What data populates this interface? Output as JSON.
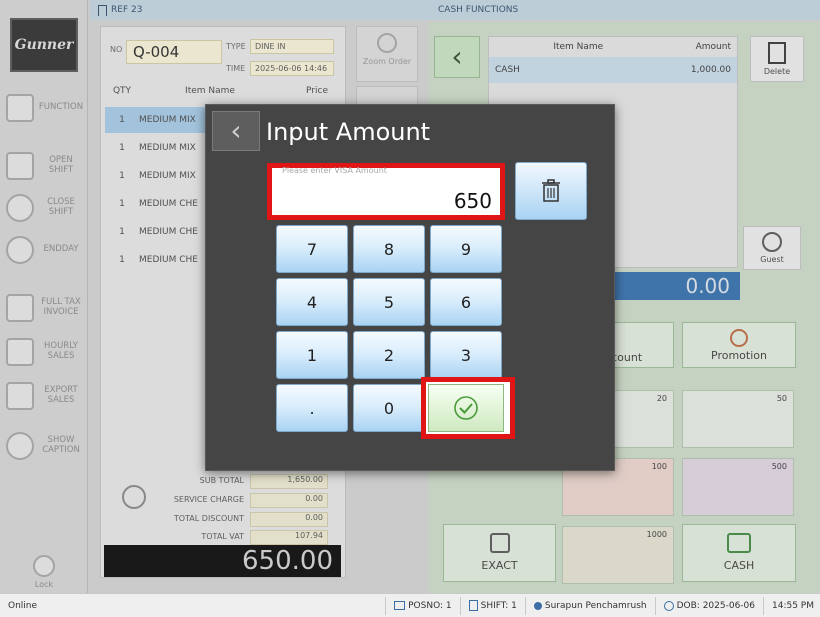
{
  "sidebar": {
    "logo_text": "Gunner",
    "items": [
      {
        "label": "FUNCTION",
        "icon": "menu-icon"
      },
      {
        "label": "OPEN SHIFT",
        "icon": "register-icon"
      },
      {
        "label": "CLOSE SHIFT",
        "icon": "clock-icon"
      },
      {
        "label": "ENDDAY",
        "icon": "gear-icon"
      },
      {
        "label": "FULL TAX INVOICE",
        "icon": "invoice-icon"
      },
      {
        "label": "HOURLY SALES",
        "icon": "report-icon"
      },
      {
        "label": "EXPORT SALES",
        "icon": "export-icon"
      },
      {
        "label": "SHOW CAPTION",
        "icon": "help-icon"
      }
    ],
    "lock_label": "Lock"
  },
  "order": {
    "ref_label": "REF 23",
    "no_label": "NO",
    "no_value": "Q-004",
    "type_label": "TYPE",
    "type_value": "DINE IN",
    "time_label": "TIME",
    "time_value": "2025-06-06 14:46",
    "col_qty": "QTY",
    "col_item": "Item Name",
    "col_price": "Price",
    "items": [
      {
        "qty": "1",
        "name": "MEDIUM MIX"
      },
      {
        "qty": "1",
        "name": "MEDIUM MIX"
      },
      {
        "qty": "1",
        "name": "MEDIUM MIX"
      },
      {
        "qty": "1",
        "name": "MEDIUM CHE"
      },
      {
        "qty": "1",
        "name": "MEDIUM CHE"
      },
      {
        "qty": "1",
        "name": "MEDIUM CHE"
      }
    ],
    "sub_total_label": "SUB TOTAL",
    "sub_total": "1,650.00",
    "service_charge_label": "SERVICE CHARGE",
    "service_charge": "0.00",
    "total_discount_label": "TOTAL DISCOUNT",
    "total_discount": "0.00",
    "total_vat_label": "TOTAL VAT",
    "total_vat": "107.94",
    "grand_total": "650.00",
    "zoom_label": "Zoom Order"
  },
  "cash": {
    "header": "CASH FUNCTIONS",
    "col_item": "Item Name",
    "col_amount": "Amount",
    "rows": [
      {
        "name": "CASH",
        "amount": "1,000.00"
      }
    ],
    "delete_label": "Delete",
    "guest_label": "Guest",
    "total": "0.00",
    "discount_label": "Discount",
    "promotion_label": "Promotion",
    "exact_label": "EXACT",
    "cash_label": "CASH",
    "notes": [
      "20",
      "50",
      "100",
      "500",
      "1000"
    ]
  },
  "modal": {
    "title": "Input Amount",
    "placeholder": "Please enter VISA Amount",
    "value": "650",
    "keys": [
      "7",
      "8",
      "9",
      "4",
      "5",
      "6",
      "1",
      "2",
      "3",
      ".",
      "0"
    ]
  },
  "status": {
    "online": "Online",
    "posno": "POSNO: 1",
    "shift": "SHIFT: 1",
    "user": "Surapun Penchamrush",
    "dob": "DOB: 2025-06-06",
    "time": "14:55 PM"
  },
  "colors": {
    "highlight_red": "#e01515",
    "modal_bg": "#454545",
    "keypad_blue": "#a9d3f3",
    "total_blue": "#2f6fb2"
  }
}
